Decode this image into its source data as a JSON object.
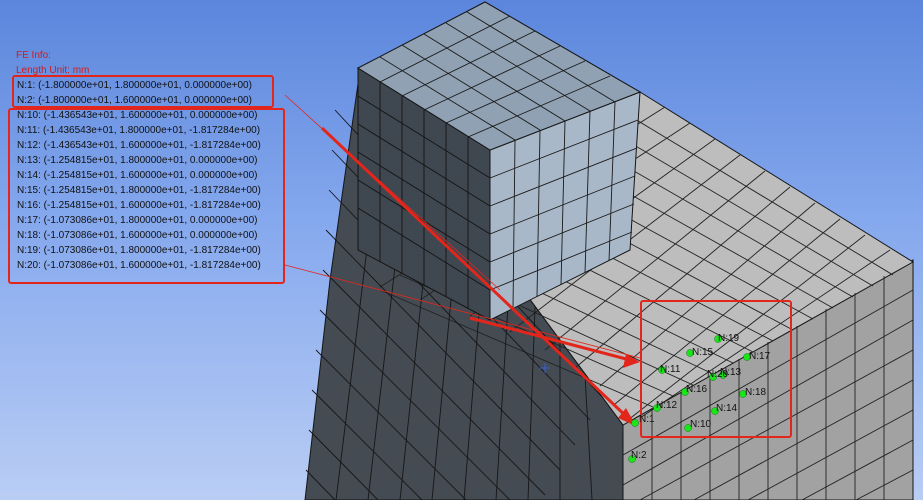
{
  "fe_info": {
    "title": "FE Info:",
    "length_unit": "Length Unit: mm",
    "group1": [
      "N:1: (-1.800000e+01, 1.800000e+01, 0.000000e+00)",
      "N:2: (-1.800000e+01, 1.600000e+01, 0.000000e+00)"
    ],
    "group2": [
      "N:10: (-1.436543e+01, 1.600000e+01, 0.000000e+00)",
      "N:11: (-1.436543e+01, 1.800000e+01, -1.817284e+00)",
      "N:12: (-1.436543e+01, 1.600000e+01, -1.817284e+00)",
      "N:13: (-1.254815e+01, 1.800000e+01, 0.000000e+00)",
      "N:14: (-1.254815e+01, 1.600000e+01, 0.000000e+00)",
      "N:15: (-1.254815e+01, 1.800000e+01, -1.817284e+00)",
      "N:16: (-1.254815e+01, 1.600000e+01, -1.817284e+00)",
      "N:17: (-1.073086e+01, 1.800000e+01, 0.000000e+00)",
      "N:18: (-1.073086e+01, 1.600000e+01, 0.000000e+00)",
      "N:19: (-1.073086e+01, 1.800000e+01, -1.817284e+00)",
      "N:20: (-1.073086e+01, 1.600000e+01, -1.817284e+00)"
    ]
  },
  "node_labels": {
    "n1": "N:1",
    "n2": "N:2",
    "n10": "N:10",
    "n11": "N:11",
    "n12": "N:12",
    "n13": "N:13",
    "n14": "N:14",
    "n15": "N:15",
    "n16": "N:16",
    "n17": "N:17",
    "n18": "N:18",
    "n19": "N:19",
    "n20": "N:20"
  },
  "colors": {
    "annotation_red": "#e3261b",
    "node_green": "#19e619",
    "face_top": "#bcbcbc",
    "face_left": "#424a52",
    "face_right": "#9e9e9e",
    "small_cube_top": "#8ea0b2",
    "small_cube_right": "#a9b8c8",
    "mesh_line": "#141414"
  }
}
